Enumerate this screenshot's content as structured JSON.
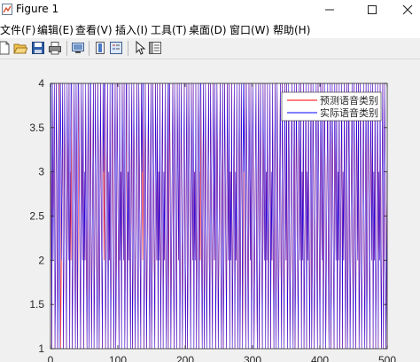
{
  "window": {
    "title": "Figure 1",
    "accent_color": "#3a6fb0"
  },
  "menu": {
    "items": [
      "文件(F)",
      "编辑(E)",
      "查看(V)",
      "插入(I)",
      "工具(T)",
      "桌面(D)",
      "窗口(W)",
      "帮助(H)"
    ]
  },
  "toolbar": {
    "icons": [
      "new-figure-icon",
      "open-file-icon",
      "save-icon",
      "print-icon",
      "print-preview-icon",
      "colorbar-icon",
      "legend-icon",
      "pointer-icon",
      "property-editor-icon"
    ]
  },
  "chart_data": {
    "type": "line",
    "xlim": [
      0,
      500
    ],
    "ylim": [
      1,
      4
    ],
    "x_ticks": [
      0,
      100,
      200,
      300,
      400,
      500
    ],
    "y_ticks": [
      1,
      1.5,
      2,
      2.5,
      3,
      3.5,
      4
    ],
    "y_tick_labels": [
      "1",
      "1.5",
      "2",
      "2.5",
      "3",
      "3.5",
      "4"
    ],
    "x_tick_labels": [
      "0",
      "100",
      "200",
      "300",
      "400",
      "500"
    ],
    "legend_position": "top-right",
    "grid": false,
    "series": [
      {
        "name": "预测语音类别",
        "color": "#ff0000",
        "values": [
          3,
          1,
          4,
          2,
          3,
          4,
          1,
          2,
          4,
          3,
          1,
          2,
          4,
          4,
          3,
          1,
          2,
          3,
          4,
          1,
          2,
          4,
          3,
          2,
          1,
          4,
          3,
          2,
          4,
          1,
          3,
          2,
          4,
          1,
          2,
          3,
          4,
          2,
          1,
          4,
          3,
          1,
          2,
          4,
          3,
          2,
          1,
          4,
          3,
          2,
          4,
          1,
          3,
          2,
          4,
          2,
          1,
          3,
          4,
          1,
          2,
          4,
          3,
          1,
          2,
          3,
          4,
          1,
          2,
          4,
          3,
          2,
          1,
          4,
          3,
          1,
          2,
          4,
          3,
          2,
          1,
          4,
          3,
          2,
          4,
          1,
          2,
          3,
          4,
          1,
          3,
          2,
          4,
          1,
          2,
          3,
          4,
          2,
          1,
          3,
          4,
          1,
          2,
          4,
          3,
          2,
          1,
          4,
          2,
          3,
          1,
          4,
          3,
          2,
          4,
          1,
          2,
          3,
          4,
          1,
          3,
          2,
          4,
          2,
          1,
          3,
          4,
          1,
          2,
          4,
          3,
          1,
          2,
          3,
          4,
          2,
          1,
          4,
          3,
          2,
          1,
          4,
          3,
          2,
          4,
          1,
          2,
          4,
          3,
          1,
          2,
          3,
          4,
          2,
          1,
          3,
          4,
          1,
          2,
          4,
          3,
          2,
          1,
          4,
          3,
          2,
          4,
          1,
          3,
          2,
          4,
          1,
          2,
          3,
          4,
          1,
          3,
          2,
          4,
          2,
          1,
          3,
          4,
          1,
          2,
          4,
          3,
          1,
          2,
          3,
          4,
          2,
          1,
          4,
          3,
          2,
          1,
          4,
          3,
          2,
          4,
          1,
          2,
          4,
          3,
          1,
          2,
          3,
          4,
          2,
          1,
          3,
          4,
          1,
          2,
          4,
          3,
          2,
          1,
          4,
          3,
          2,
          4,
          1,
          3,
          2,
          4,
          1,
          2,
          3,
          4,
          1,
          3,
          2,
          4,
          2,
          1,
          3,
          4,
          1,
          2,
          4,
          3,
          1,
          2,
          3,
          4,
          2,
          1,
          4,
          3,
          2,
          1,
          4,
          3,
          2,
          4,
          1,
          2,
          4,
          3,
          1,
          2,
          3,
          4,
          2,
          1,
          3,
          4,
          1,
          2,
          4,
          3,
          2,
          1,
          4,
          3,
          2,
          4,
          1,
          3,
          2,
          4,
          1,
          2,
          3,
          4,
          1,
          3,
          2,
          4,
          2,
          1,
          3,
          4,
          1,
          2,
          4,
          3,
          1,
          2,
          3,
          4,
          2,
          1,
          4,
          3,
          2,
          1,
          4,
          3,
          2,
          4,
          1,
          2,
          4,
          3,
          1,
          2,
          3,
          4,
          2,
          1,
          3,
          4,
          1,
          2,
          4,
          3,
          2,
          1,
          4,
          3,
          2,
          4,
          1,
          3,
          2,
          4,
          1,
          2,
          3,
          4,
          1,
          3,
          2,
          4,
          2,
          1,
          3,
          4,
          1,
          2,
          4,
          3,
          1,
          2,
          3,
          4,
          2,
          1,
          4,
          3,
          2,
          1,
          4,
          3,
          2,
          4,
          1,
          2,
          4,
          3,
          1,
          2,
          3,
          4,
          2,
          1,
          3,
          4,
          1,
          2,
          4,
          3,
          2,
          1,
          4,
          3,
          2,
          4,
          1,
          3,
          2,
          4,
          1,
          2,
          3,
          4,
          1,
          3,
          2,
          4,
          2,
          1,
          3,
          4,
          1,
          2,
          4,
          3,
          1,
          2,
          3,
          4,
          2,
          1,
          4,
          3,
          2,
          1,
          4,
          3,
          2,
          4,
          1,
          2,
          4,
          3,
          1,
          2,
          3,
          4,
          2,
          1,
          3,
          4,
          1,
          2,
          4,
          3,
          2,
          1,
          4,
          3,
          2,
          4,
          1,
          3,
          2,
          4,
          1,
          2,
          3,
          4,
          1,
          3,
          2,
          4,
          2,
          1,
          3,
          4,
          1,
          2,
          4,
          3,
          1,
          2,
          3,
          4,
          2,
          1,
          4,
          3,
          2,
          1,
          4,
          3,
          2,
          4,
          1,
          2,
          4,
          3,
          1,
          2,
          3,
          4,
          2,
          1,
          3,
          4,
          1,
          2,
          4,
          3,
          2,
          1,
          4,
          3,
          2,
          4,
          1,
          3,
          2,
          4,
          1,
          2,
          3,
          4,
          1,
          3,
          2,
          4,
          2,
          1,
          3,
          4,
          1,
          2,
          4,
          3,
          1,
          2,
          3
        ]
      },
      {
        "name": "实际语音类别",
        "color": "#0000ff",
        "values": [
          4,
          1,
          4,
          2,
          3,
          4,
          1,
          2,
          4,
          3,
          1,
          2,
          4,
          1,
          3,
          4,
          2,
          3,
          4,
          1,
          2,
          4,
          3,
          2,
          1,
          4,
          3,
          2,
          4,
          1,
          3,
          4,
          4,
          1,
          2,
          3,
          4,
          2,
          1,
          4,
          3,
          1,
          4,
          4,
          3,
          2,
          1,
          4,
          3,
          2,
          4,
          1,
          3,
          2,
          4,
          2,
          1,
          3,
          4,
          1,
          2,
          4,
          4,
          1,
          2,
          3,
          4,
          1,
          2,
          4,
          3,
          2,
          1,
          4,
          3,
          1,
          2,
          4,
          3,
          2,
          1,
          4,
          3,
          4,
          4,
          1,
          2,
          3,
          4,
          1,
          3,
          2,
          4,
          1,
          2,
          4,
          4,
          2,
          1,
          3,
          4,
          1,
          2,
          4,
          3,
          2,
          1,
          4,
          2,
          3,
          1,
          4,
          3,
          2,
          4,
          1,
          2,
          4,
          4,
          1,
          3,
          2,
          4,
          2,
          1,
          3,
          4,
          1,
          2,
          4,
          3,
          1,
          2,
          3,
          4,
          2,
          1,
          4,
          3,
          2,
          1,
          4,
          3,
          4,
          4,
          1,
          2,
          4,
          3,
          1,
          2,
          3,
          4,
          2,
          1,
          3,
          4,
          1,
          2,
          4,
          3,
          2,
          1,
          4,
          3,
          2,
          4,
          1,
          3,
          2,
          4,
          1,
          2,
          3,
          4,
          1,
          3,
          2,
          4,
          2,
          1,
          3,
          4,
          1,
          4,
          4,
          3,
          1,
          2,
          3,
          4,
          2,
          1,
          4,
          3,
          2,
          1,
          4,
          3,
          2,
          4,
          1,
          2,
          4,
          3,
          1,
          2,
          3,
          4,
          2,
          1,
          3,
          4,
          1,
          2,
          4,
          3,
          2,
          1,
          4,
          3,
          2,
          4,
          1,
          3,
          2,
          4,
          1,
          2,
          3,
          4,
          1,
          3,
          4,
          4,
          2,
          1,
          3,
          4,
          1,
          2,
          4,
          3,
          1,
          2,
          3,
          4,
          2,
          1,
          4,
          3,
          2,
          1,
          4,
          3,
          2,
          4,
          1,
          2,
          4,
          3,
          1,
          2,
          3,
          4,
          2,
          1,
          3,
          4,
          1,
          2,
          4,
          3,
          2,
          1,
          4,
          3,
          2,
          4,
          1,
          3,
          2,
          4,
          1,
          2,
          3,
          4,
          1,
          3,
          2,
          4,
          2,
          1,
          3,
          4,
          1,
          2,
          4,
          3,
          1,
          4,
          3,
          4,
          2,
          1,
          4,
          3,
          2,
          1,
          4,
          3,
          2,
          4,
          1,
          2,
          4,
          3,
          1,
          2,
          3,
          4,
          2,
          1,
          3,
          4,
          1,
          2,
          4,
          3,
          2,
          1,
          4,
          3,
          2,
          4,
          1,
          3,
          2,
          4,
          1,
          2,
          3,
          4,
          1,
          3,
          2,
          4,
          2,
          1,
          3,
          4,
          1,
          2,
          4,
          3,
          1,
          2,
          3,
          4,
          2,
          1,
          4,
          3,
          2,
          1,
          4,
          3,
          2,
          4,
          1,
          2,
          4,
          3,
          1,
          2,
          3,
          4,
          2,
          1,
          3,
          4,
          1,
          2,
          4,
          3,
          2,
          1,
          4,
          3,
          2,
          4,
          1,
          3,
          2,
          4,
          1,
          2,
          3,
          4,
          1,
          3,
          2,
          4,
          2,
          1,
          3,
          4,
          1,
          2,
          4,
          3,
          1,
          2,
          3,
          4,
          2,
          1,
          4,
          3,
          2,
          1,
          4,
          3,
          2,
          4,
          1,
          2,
          4,
          3,
          1,
          2,
          3,
          4,
          2,
          1,
          3,
          4,
          1,
          2,
          4,
          3,
          2,
          1,
          4,
          3,
          2,
          4,
          1,
          3,
          2,
          4,
          1,
          2,
          3,
          4,
          1,
          3,
          2,
          4,
          2,
          1,
          3,
          4,
          1,
          2,
          4,
          3,
          1,
          2,
          3,
          4,
          2,
          1,
          4,
          3,
          2,
          1,
          4,
          3,
          2,
          4,
          1,
          2,
          4,
          3,
          1,
          2,
          3,
          4,
          2,
          1,
          3,
          4,
          1,
          2,
          4,
          3,
          2,
          1,
          4,
          3,
          2,
          4,
          1,
          3,
          2,
          4,
          1,
          2,
          3,
          4,
          1,
          3,
          2,
          4,
          2,
          1,
          3,
          4,
          1,
          2,
          4,
          3,
          1,
          2,
          3
        ]
      }
    ]
  }
}
